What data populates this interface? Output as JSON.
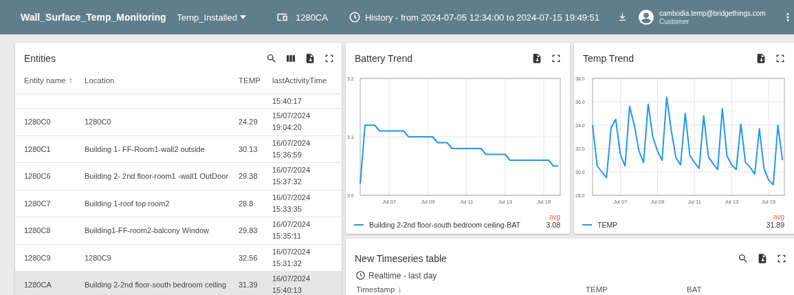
{
  "header": {
    "title": "Wall_Surface_Temp_Monitoring",
    "state": "Temp_Installed",
    "device": "1280CA",
    "history": "History - from 2024-07-05 12:34:00 to 2024-07-15 19:49:51",
    "user": {
      "email": "cambodia.temp@bridgethings.com",
      "role": "Customer"
    }
  },
  "entities": {
    "title": "Entities",
    "columns": [
      {
        "label": "Entity name",
        "sort_arrow": "↑"
      },
      {
        "label": "Location"
      },
      {
        "label": "TEMP"
      },
      {
        "label": "lastActivityTime"
      }
    ],
    "rows": [
      {
        "kind": "partial",
        "time": "15:40:17",
        "selected": false
      },
      {
        "kind": "full",
        "name": "1280C0",
        "location": "1280C0",
        "temp": "24.29",
        "date": "15/07/2024",
        "time": "19:04:20",
        "selected": false
      },
      {
        "kind": "full",
        "name": "1280C1",
        "location": "Building 1- FF-Room1-wall2 outside",
        "temp": "30.13",
        "date": "16/07/2024",
        "time": "15:36:59",
        "selected": false
      },
      {
        "kind": "full",
        "name": "1280C6",
        "location": "Building 2- 2nd floor-room1 -wall1 OutDoor",
        "temp": "29.38",
        "date": "16/07/2024",
        "time": "15:37:32",
        "selected": false
      },
      {
        "kind": "full",
        "name": "1280C7",
        "location": "Building 1-roof top room2",
        "temp": "28.8",
        "date": "16/07/2024",
        "time": "15:33:35",
        "selected": false
      },
      {
        "kind": "full",
        "name": "1280C8",
        "location": "Building1-FF-room2-balcony Window",
        "temp": "29.83",
        "date": "16/07/2024",
        "time": "15:35:11",
        "selected": false
      },
      {
        "kind": "full",
        "name": "1280C9",
        "location": "1280C9",
        "temp": "32.56",
        "date": "16/07/2024",
        "time": "15:31:32",
        "selected": false
      },
      {
        "kind": "full",
        "name": "1280CA",
        "location": "Building 2-2nd floor-south bedroom ceiling",
        "temp": "31.39",
        "date": "16/07/2024",
        "time": "15:40:13",
        "selected": true
      }
    ]
  },
  "charts": [
    {
      "title": "Battery Trend",
      "legend": {
        "header": "avg",
        "value": "3.08"
      },
      "chart_data": {
        "type": "line",
        "grid": true,
        "ylim": [
          3.0,
          3.2
        ],
        "yticks": [
          {
            "value": 3.0,
            "label": "3.0"
          },
          {
            "value": 3.1,
            "label": "3.1"
          },
          {
            "value": 3.2,
            "label": "3.2"
          }
        ],
        "categories": [
          null,
          null,
          null,
          null,
          null,
          null,
          "Jul 07",
          null,
          null,
          null,
          null,
          null,
          null,
          null,
          "Jul 09",
          null,
          null,
          null,
          null,
          null,
          null,
          null,
          "Jul 11",
          null,
          null,
          null,
          null,
          null,
          null,
          null,
          "Jul 13",
          null,
          null,
          null,
          null,
          null,
          null,
          null,
          "Jul 15",
          null,
          null,
          null
        ],
        "series": [
          {
            "name": "Building 2-2nd floor-south bedroom ceiling-BAT",
            "color": "#2196f3",
            "values": [
              3.02,
              3.12,
              3.12,
              3.12,
              3.11,
              3.11,
              3.11,
              3.11,
              3.11,
              3.11,
              3.1,
              3.1,
              3.1,
              3.1,
              3.1,
              3.1,
              3.09,
              3.09,
              3.09,
              3.08,
              3.08,
              3.08,
              3.08,
              3.08,
              3.08,
              3.08,
              3.07,
              3.07,
              3.07,
              3.07,
              3.07,
              3.06,
              3.06,
              3.06,
              3.06,
              3.06,
              3.06,
              3.06,
              3.06,
              3.06,
              3.05,
              3.05
            ]
          }
        ]
      }
    },
    {
      "title": "Temp Trend",
      "legend": {
        "header": "avg",
        "value": "31.89"
      },
      "chart_data": {
        "type": "line",
        "grid": true,
        "ylim": [
          28,
          38
        ],
        "yticks": [
          {
            "value": 28,
            "label": "28.0"
          },
          {
            "value": 30,
            "label": "30.0"
          },
          {
            "value": 32,
            "label": "32.0"
          },
          {
            "value": 34,
            "label": "34.0"
          },
          {
            "value": 36,
            "label": "36.0"
          },
          {
            "value": 38,
            "label": "38.0"
          }
        ],
        "categories": [
          null,
          null,
          null,
          null,
          null,
          null,
          "Jul 07",
          null,
          null,
          null,
          null,
          null,
          null,
          null,
          "Jul 09",
          null,
          null,
          null,
          null,
          null,
          null,
          null,
          "Jul 11",
          null,
          null,
          null,
          null,
          null,
          null,
          null,
          "Jul 13",
          null,
          null,
          null,
          null,
          null,
          null,
          null,
          "Jul 15",
          null,
          null,
          null
        ],
        "series": [
          {
            "name": "TEMP",
            "color": "#2196f3",
            "values": [
              34.0,
              30.5,
              30.0,
              29.5,
              33.8,
              34.5,
              31.5,
              30.5,
              35.6,
              34.0,
              31.8,
              30.8,
              35.8,
              33.0,
              31.8,
              31.0,
              36.4,
              33.5,
              31.2,
              30.6,
              35.0,
              31.4,
              30.8,
              30.3,
              34.8,
              31.3,
              30.7,
              30.2,
              35.4,
              31.4,
              30.6,
              30.2,
              34.1,
              30.8,
              30.4,
              29.8,
              33.7,
              30.3,
              29.3,
              28.9,
              34.0,
              31.0
            ]
          }
        ]
      }
    }
  ],
  "timeseries": {
    "title": "New Timeseries table",
    "timewindow": "Realtime - last day",
    "columns": [
      {
        "label": "Timestamp",
        "sort_arrow": "↓"
      },
      {
        "label": "TEMP"
      },
      {
        "label": "BAT"
      }
    ]
  }
}
